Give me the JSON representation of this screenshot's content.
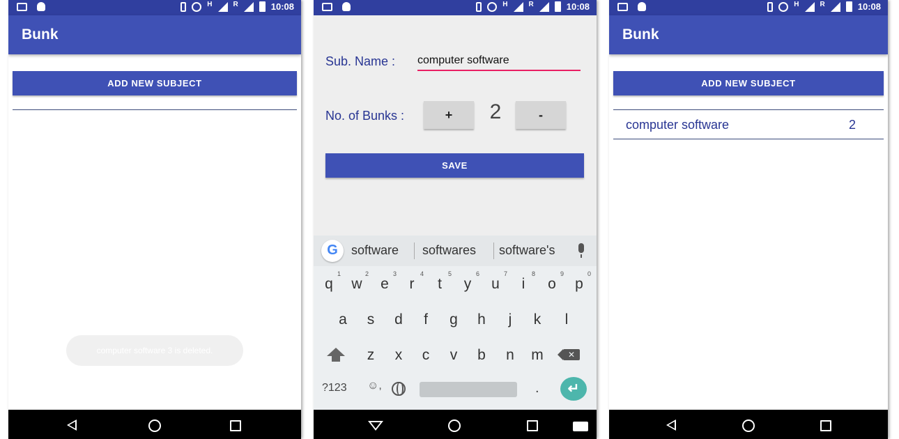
{
  "colors": {
    "primary": "#3f51b5",
    "status_bar": "#303f9f",
    "accent": "#e91e63",
    "text_blue": "#283593"
  },
  "status_bar": {
    "time": "10:08",
    "network_type": "H",
    "roaming": "R"
  },
  "screen1": {
    "app_title": "Bunk",
    "add_button_label": "ADD NEW SUBJECT",
    "toast_text": "computer software 3 is deleted."
  },
  "screen2": {
    "sub_name_label": "Sub. Name :",
    "sub_name_value": "computer software",
    "bunks_label": "No. of Bunks :",
    "plus_label": "+",
    "bunk_count": "2",
    "minus_label": "-",
    "save_label": "SAVE",
    "keyboard": {
      "suggestions": [
        "software",
        "softwares",
        "software's"
      ],
      "row1": [
        "q",
        "w",
        "e",
        "r",
        "t",
        "y",
        "u",
        "i",
        "o",
        "p"
      ],
      "row1_hints": [
        "1",
        "2",
        "3",
        "4",
        "5",
        "6",
        "7",
        "8",
        "9",
        "0"
      ],
      "row2": [
        "a",
        "s",
        "d",
        "f",
        "g",
        "h",
        "j",
        "k",
        "l"
      ],
      "row3": [
        "z",
        "x",
        "c",
        "v",
        "b",
        "n",
        "m"
      ],
      "symbols_key": "?123",
      "period_key": ".",
      "google_logo": "G",
      "icons": [
        "google-icon",
        "mic-icon",
        "shift-icon",
        "backspace-icon",
        "emoji-icon",
        "globe-icon",
        "enter-icon"
      ]
    }
  },
  "screen3": {
    "app_title": "Bunk",
    "add_button_label": "ADD NEW SUBJECT",
    "subjects": [
      {
        "name": "computer software",
        "bunks": "2"
      }
    ]
  }
}
